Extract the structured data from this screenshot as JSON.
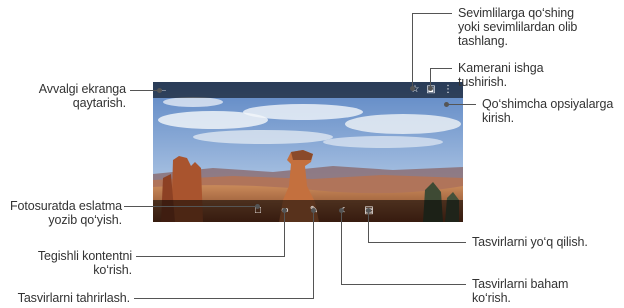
{
  "screen": {
    "callouts": {
      "back": [
        "Avvalgi ekranga",
        "qaytarish."
      ],
      "favorite": [
        "Sevimlilarga qo‘shing",
        "yoki sevimlilardan olib",
        "tashlang."
      ],
      "camera": [
        "Kamerani ishga",
        "tushirish."
      ],
      "more": [
        "Qo‘shimcha opsiyalarga",
        "kirish."
      ],
      "memo": [
        "Fotosuratda eslatma",
        "yozib qo‘yish."
      ],
      "view_content": [
        "Tegishli kontentni",
        "ko‘rish."
      ],
      "edit": [
        "Tasvirlarni tahrirlash."
      ],
      "delete": [
        "Tasvirlarni yo‘q qilish."
      ],
      "share": [
        "Tasvirlarni baham",
        "ko‘rish."
      ]
    },
    "icons": {
      "back": "back-arrow-icon",
      "favorite": "star-icon",
      "camera": "camera-icon",
      "more": "more-vertical-icon",
      "memo": "memo-icon",
      "view_content": "link-icon",
      "edit": "pencil-icon",
      "share": "share-icon",
      "delete": "trash-icon"
    },
    "colors": {
      "callout_line": "#555555",
      "callout_text": "#333333",
      "toolbar_overlay": "#000000"
    }
  }
}
